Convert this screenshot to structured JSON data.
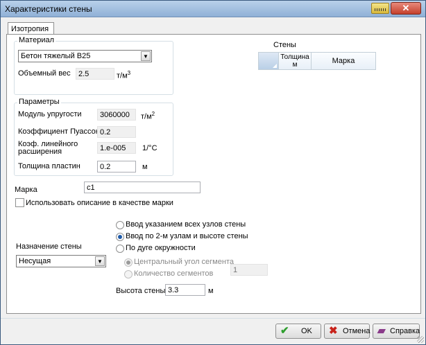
{
  "window": {
    "title": "Характеристики стены",
    "close_glyph": "✕"
  },
  "tabs": [
    {
      "label": "Изотропия"
    }
  ],
  "material": {
    "legend": "Материал",
    "combo_value": "Бетон тяжелый B25",
    "volume_weight_label": "Объемный вес",
    "volume_weight_value": "2.5",
    "volume_weight_unit": "т/м",
    "volume_weight_unit_sup": "3"
  },
  "parameters": {
    "legend": "Параметры",
    "modulus_label": "Модуль упругости",
    "modulus_value": "3060000",
    "modulus_unit": "т/м",
    "modulus_unit_sup": "2",
    "poisson_label": "Коэффициент Пуассона",
    "poisson_value": "0.2",
    "expansion_label_line1": "Коэф. линейного",
    "expansion_label_line2": "расширения",
    "expansion_value": "1.e-005",
    "expansion_unit": "1/°C",
    "thickness_label": "Толщина пластин",
    "thickness_value": "0.2",
    "thickness_unit": "м"
  },
  "walls": {
    "label": "Стены",
    "col_thickness": "Толщина",
    "col_thickness_unit": "м",
    "col_mark": "Марка"
  },
  "mark": {
    "label": "Марка",
    "value": "c1"
  },
  "use_description": {
    "label": "Использовать описание в качестве марки",
    "checked": false
  },
  "input_mode": {
    "options": [
      {
        "label": "Ввод указанием всех узлов стены",
        "checked": false
      },
      {
        "label": "Ввод по 2-м узлам и высоте стены",
        "checked": true
      },
      {
        "label": "По дуге окружности",
        "checked": false
      }
    ],
    "arc_options": [
      {
        "label": "Центральный угол сегмента",
        "checked": true
      },
      {
        "label": "Количество сегментов",
        "checked": false
      }
    ],
    "segments_value": "1"
  },
  "purpose": {
    "label": "Назначение стены",
    "value": "Несущая"
  },
  "height": {
    "label": "Высота стены",
    "value": "3.3",
    "unit": "м"
  },
  "footer": {
    "ok": "OK",
    "cancel": "Отмена",
    "help": "Справка"
  },
  "colors": {
    "ok_icon": "#2e9e2e",
    "cancel_icon": "#c8231b",
    "help_icon": "#8a3a8a"
  }
}
